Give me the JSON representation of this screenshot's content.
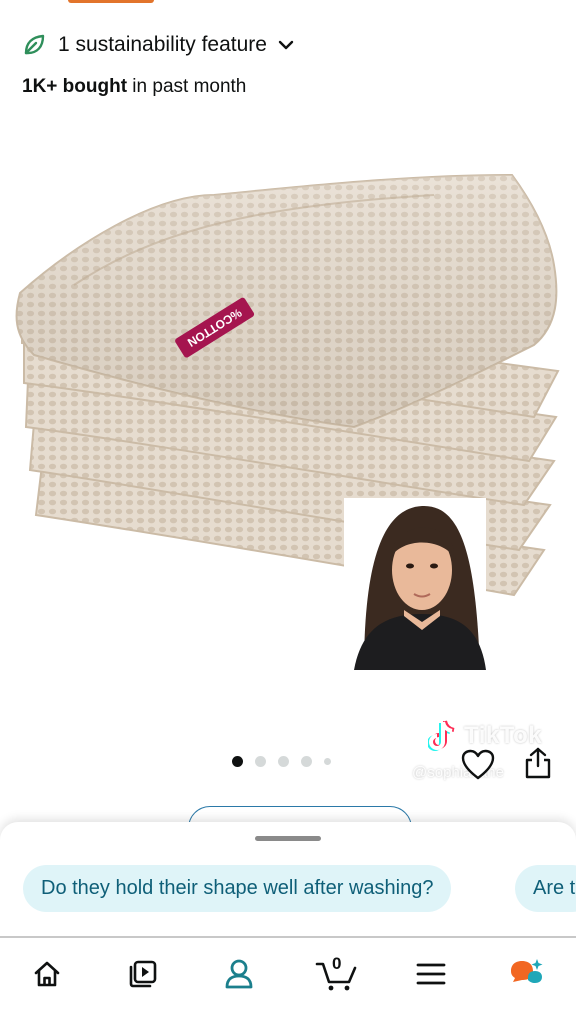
{
  "header": {
    "sustainability_label": "1 sustainability feature",
    "bought_count": "1K+ bought",
    "bought_suffix": " in past month"
  },
  "product": {
    "tag_text": "%COTTON"
  },
  "carousel": {
    "total_dots": 5,
    "active_index": 0
  },
  "tiktok": {
    "brand": "TikTok",
    "handle": "@sophia.lane"
  },
  "questions": {
    "chips": [
      "Do they hold their shape well after washing?",
      "Are t"
    ]
  },
  "bottom_nav": {
    "items": [
      "home-icon",
      "video-icon",
      "profile-icon",
      "cart-icon",
      "menu-icon",
      "rufus-icon"
    ],
    "cart_count": "0",
    "active": "profile-icon"
  },
  "colors": {
    "accent": "#e2742b",
    "leaf": "#2f8f5b",
    "chip_bg": "#dff4f8",
    "chip_text": "#0f5f78",
    "active_nav": "#1b7f8c",
    "rufus_orange": "#f26722",
    "rufus_teal": "#1fa7b8"
  }
}
